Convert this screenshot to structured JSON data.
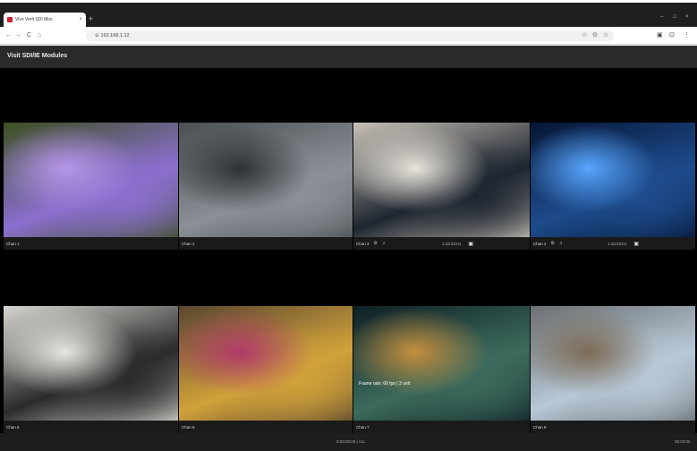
{
  "browser": {
    "tab_title": "Vivo Verlt SDI Mos",
    "tab_close": "×",
    "new_tab": "+",
    "window_controls": [
      "–",
      "□",
      "×"
    ],
    "nav": {
      "back": "←",
      "forward": "→",
      "reload": "C",
      "home": "⌂"
    },
    "url": "① 192.168.1.12",
    "toolbar_icons": [
      "☆",
      "⊙",
      "☆"
    ],
    "right_icons": [
      "▣",
      "⊡",
      "⋮"
    ]
  },
  "app": {
    "title": "Visit SDI/IE Modules"
  },
  "cells": [
    {
      "name": "Chan 1",
      "show_controls": false,
      "time": "",
      "colors": [
        "#3c5020",
        "#8b6fcf",
        "#b595e8"
      ]
    },
    {
      "name": "Chan 2",
      "show_controls": false,
      "time": "",
      "colors": [
        "#4a4f52",
        "#8a9096",
        "#2e3235"
      ]
    },
    {
      "name": "Chan 3",
      "show_controls": true,
      "time": "1:15:23:01",
      "colors": [
        "#c9c2b8",
        "#1f2630",
        "#e9e4dc"
      ]
    },
    {
      "name": "Chan 4",
      "show_controls": true,
      "time": "1:15:23:01",
      "colors": [
        "#061634",
        "#1d4b8c",
        "#58a6ff"
      ]
    },
    {
      "name": "Chan 5",
      "show_controls": false,
      "time": "",
      "colors": [
        "#d9d6d0",
        "#2b2b2b",
        "#e8e6e0"
      ]
    },
    {
      "name": "Chan 6",
      "show_controls": false,
      "time": "",
      "colors": [
        "#5a4630",
        "#d1a23a",
        "#b03a6a"
      ]
    },
    {
      "name": "Chan 7",
      "show_controls": false,
      "time": "",
      "overlay_text": "Frame rate: 60 fps | 3 unit",
      "colors": [
        "#0f2025",
        "#3c6a5c",
        "#c48e3d"
      ]
    },
    {
      "name": "Chan 8",
      "show_controls": false,
      "time": "",
      "colors": [
        "#6b6f72",
        "#b7c8d6",
        "#7d6b55"
      ]
    }
  ],
  "icons": {
    "settings": "⚙",
    "audio": "♫",
    "snapshot": "▣"
  },
  "status": {
    "mid": "0:00:00:00 | ALL",
    "right": "00:00:00"
  }
}
